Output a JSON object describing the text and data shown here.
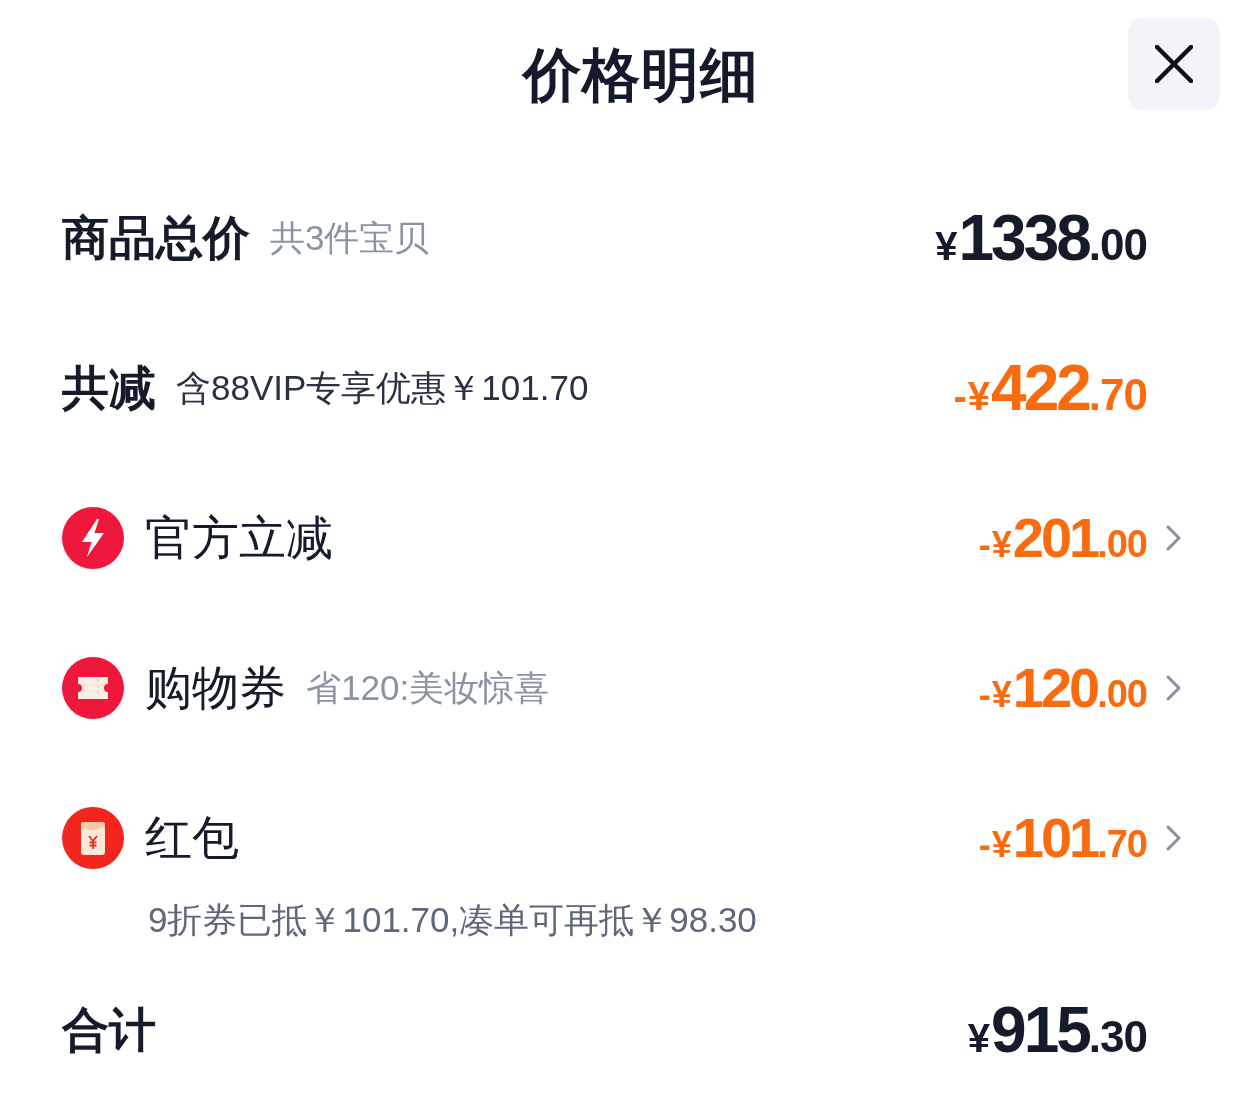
{
  "title": "价格明细",
  "rows": [
    {
      "kind": "subtotal",
      "label": "商品总价",
      "note": "共3件宝贝",
      "amount": {
        "prefix": "¥",
        "integer": "1338",
        "decimal": ".00"
      }
    },
    {
      "kind": "savings",
      "label": "共减",
      "note": "含88VIP专享优惠￥101.70",
      "amount": {
        "prefix": "-¥",
        "integer": "422",
        "decimal": ".70"
      }
    },
    {
      "kind": "instant",
      "label": "官方立减",
      "amount": {
        "prefix": "-¥",
        "integer": "201",
        "decimal": ".00"
      }
    },
    {
      "kind": "coupon",
      "label": "购物券",
      "note": "省120:美妆惊喜",
      "amount": {
        "prefix": "-¥",
        "integer": "120",
        "decimal": ".00"
      }
    },
    {
      "kind": "packet",
      "label": "红包",
      "amount": {
        "prefix": "-¥",
        "integer": "101",
        "decimal": ".70"
      },
      "detail": "9折券已抵￥101.70,凑单可再抵￥98.30"
    },
    {
      "kind": "total",
      "label": "合计",
      "amount": {
        "prefix": "¥",
        "integer": "915",
        "decimal": ".30"
      }
    }
  ]
}
